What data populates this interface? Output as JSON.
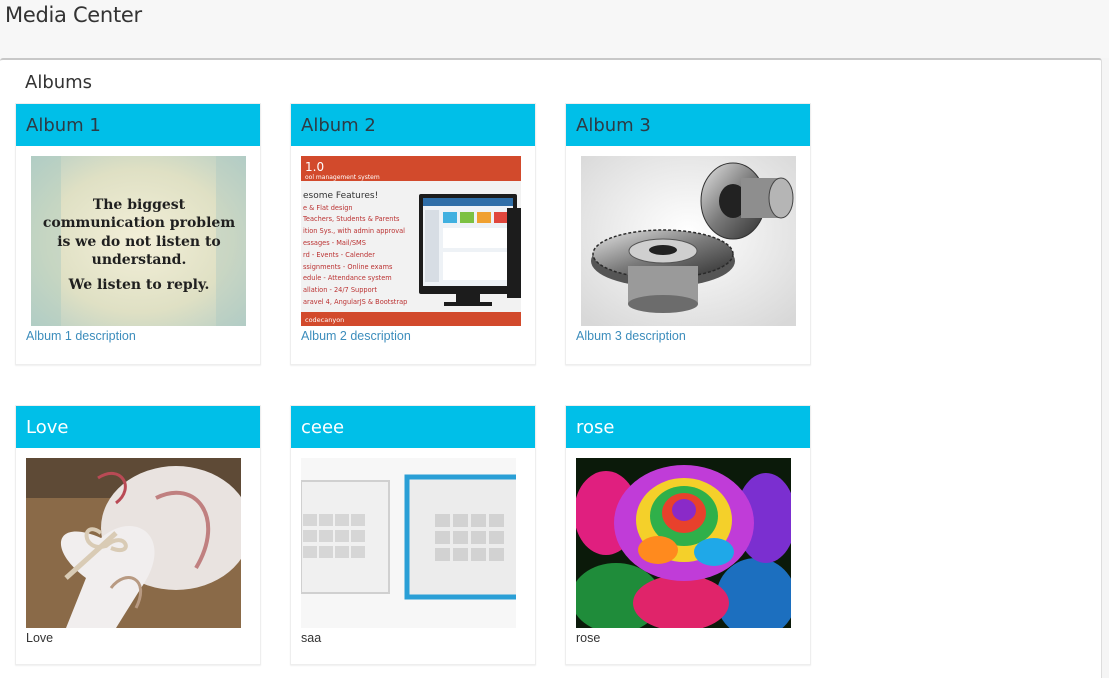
{
  "app": {
    "title": "Media Center"
  },
  "panel": {
    "title": "Albums"
  },
  "albums": [
    {
      "title": "Album 1",
      "description": "Album 1 description",
      "image_text": [
        "The biggest",
        "communication problem",
        "is we do not listen to",
        "understand.",
        "We listen to reply."
      ]
    },
    {
      "title": "Album 2",
      "description": "Album 2 description",
      "image_text": [
        "1.0",
        "ool management system",
        "esome Features!",
        "e & Flat design",
        "Teachers, Students & Parents",
        "ition Sys., with admin approval",
        "essages - Mail/SMS",
        "rd - Events - Calender",
        "ssignments - Online exams",
        "edule - Attendance system",
        "allation - 24/7 Support",
        "aravel 4, AngularJS & Bootstrap",
        "codecanyon"
      ]
    },
    {
      "title": "Album 3",
      "description": "Album 3 description"
    },
    {
      "title": "Love",
      "description": "Love"
    },
    {
      "title": "ceee",
      "description": "saa"
    },
    {
      "title": "rose",
      "description": "rose"
    }
  ],
  "colors": {
    "header": "#00bfe8",
    "link": "#3c8dbc"
  }
}
